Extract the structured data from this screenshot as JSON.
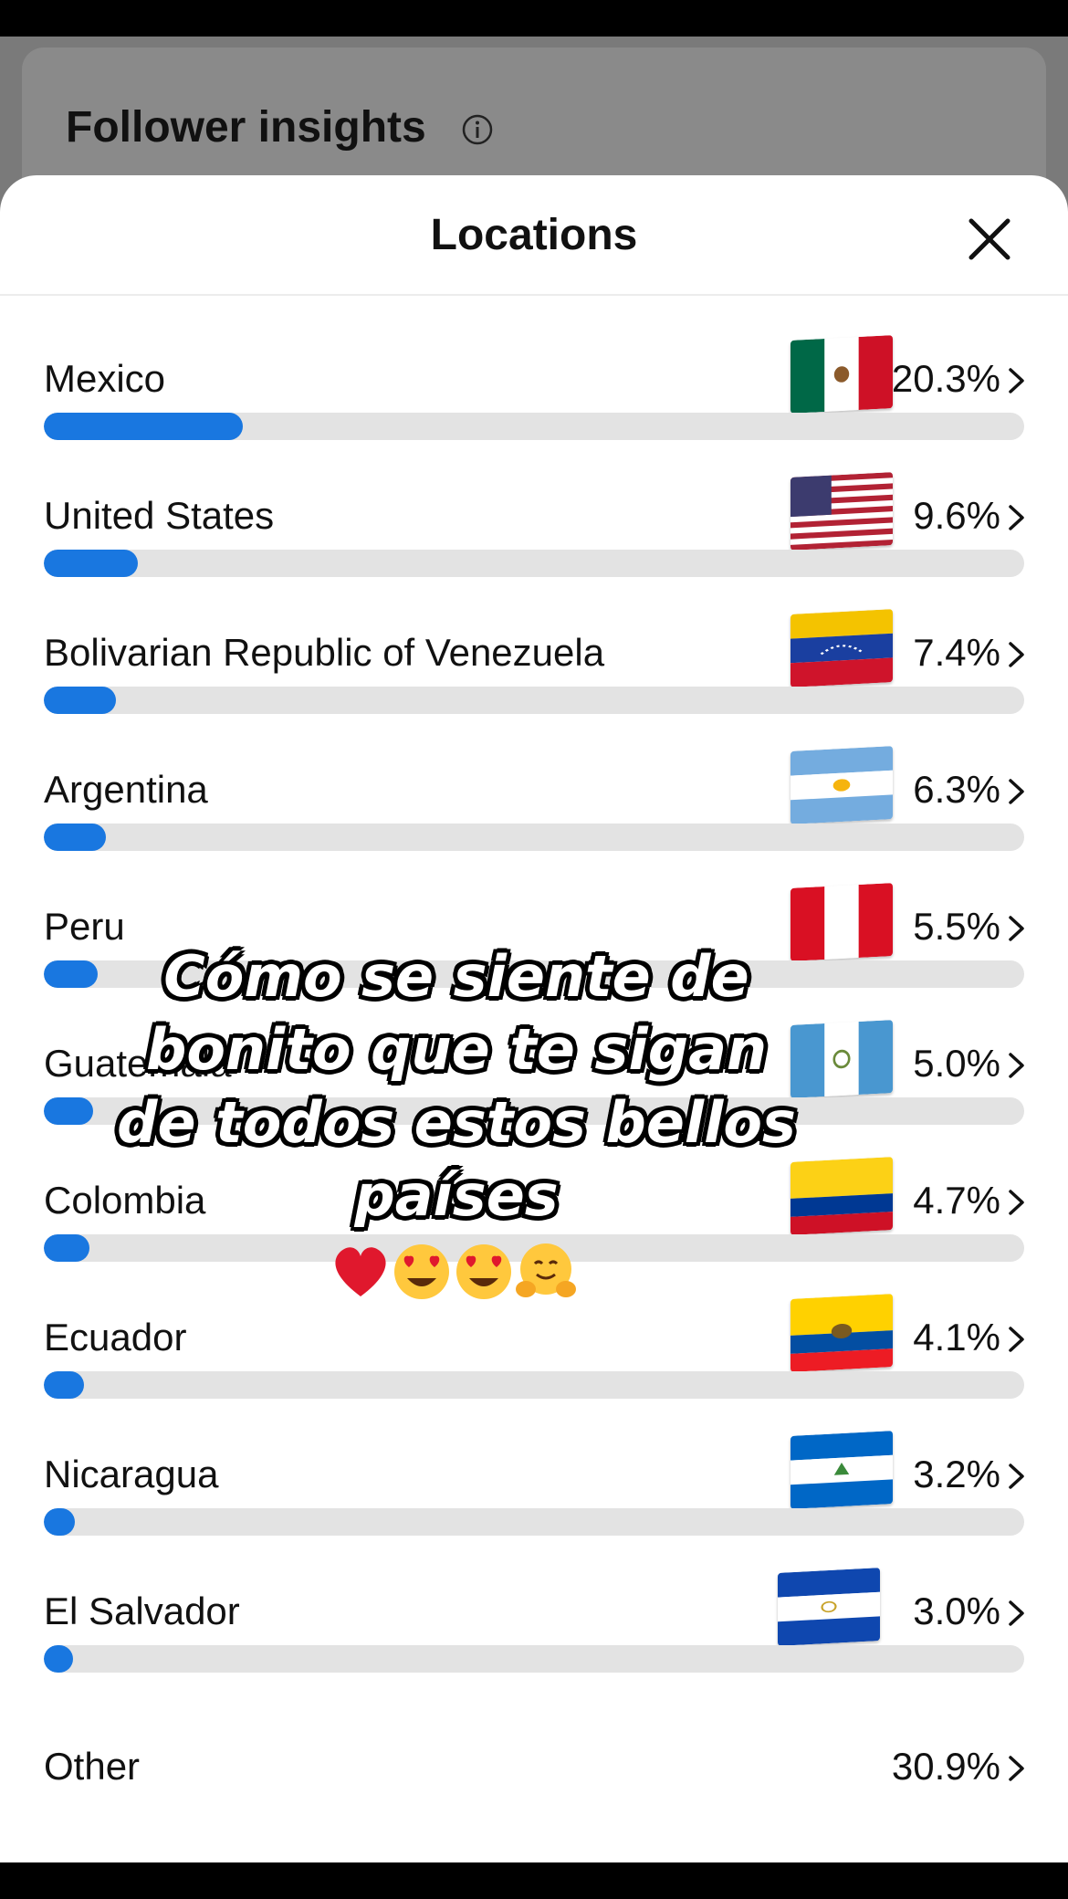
{
  "background": {
    "title": "Follower insights",
    "info_icon": "info-icon"
  },
  "sheet": {
    "title": "Locations",
    "close_icon": "close-icon",
    "chevron_icon": "chevron-right-icon",
    "accent_color": "#1977e0",
    "track_color": "#e3e3e3"
  },
  "locations": [
    {
      "country": "Mexico",
      "percent_label": "20.3%",
      "percent": 20.3,
      "flag": "flag-mexico"
    },
    {
      "country": "United States",
      "percent_label": "9.6%",
      "percent": 9.6,
      "flag": "flag-united-states"
    },
    {
      "country": "Bolivarian Republic of Venezuela",
      "percent_label": "7.4%",
      "percent": 7.4,
      "flag": "flag-venezuela"
    },
    {
      "country": "Argentina",
      "percent_label": "6.3%",
      "percent": 6.3,
      "flag": "flag-argentina"
    },
    {
      "country": "Peru",
      "percent_label": "5.5%",
      "percent": 5.5,
      "flag": "flag-peru"
    },
    {
      "country": "Guatemala",
      "percent_label": "5.0%",
      "percent": 5.0,
      "flag": "flag-guatemala"
    },
    {
      "country": "Colombia",
      "percent_label": "4.7%",
      "percent": 4.7,
      "flag": "flag-colombia"
    },
    {
      "country": "Ecuador",
      "percent_label": "4.1%",
      "percent": 4.1,
      "flag": "flag-ecuador"
    },
    {
      "country": "Nicaragua",
      "percent_label": "3.2%",
      "percent": 3.2,
      "flag": "flag-nicaragua"
    },
    {
      "country": "El Salvador",
      "percent_label": "3.0%",
      "percent": 3.0,
      "flag": "flag-el-salvador"
    }
  ],
  "other": {
    "country": "Other",
    "percent_label": "30.9%"
  },
  "overlay": {
    "caption": "Cómo se siente de bonito que te sigan de todos estos bellos países",
    "emojis": [
      "red-heart",
      "heart-eyes-face",
      "heart-eyes-face",
      "hugging-face"
    ]
  }
}
